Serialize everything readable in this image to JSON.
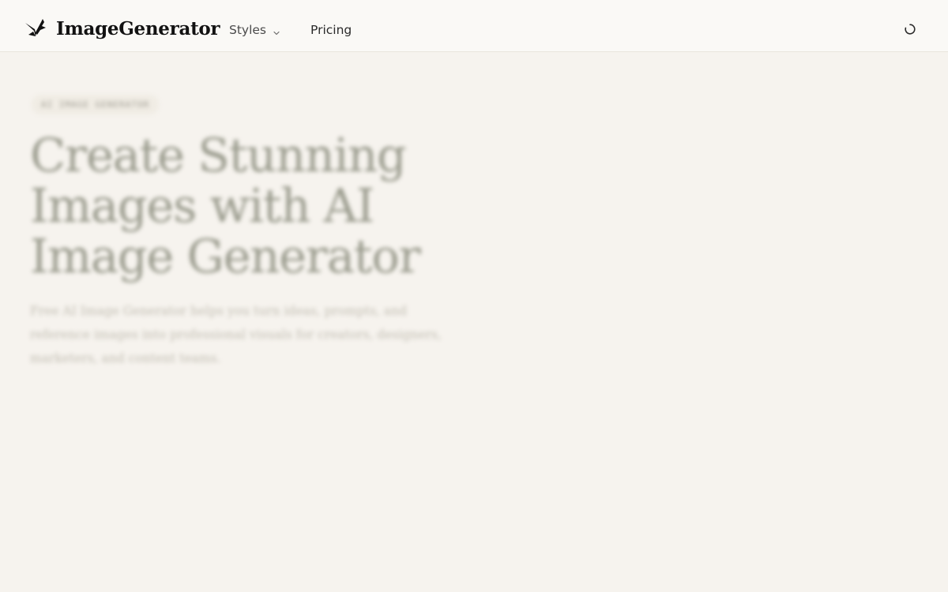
{
  "header": {
    "brand_name": "ImageGenerator",
    "logo_icon": "crane-bird-icon",
    "nav": {
      "styles_label": "Styles",
      "pricing_label": "Pricing"
    },
    "status_icon": "loading-spinner-icon"
  },
  "hero": {
    "eyebrow": "AI IMAGE GENERATOR",
    "headline": "Create Stunning Images with AI Image Generator",
    "description": "Free AI Image Generator helps you turn ideas, prompts, and reference images into professional visuals for creators, designers, marketers, and content teams."
  },
  "colors": {
    "page_background": "#f6f3ee",
    "header_background": "#faf9f6",
    "headline_text": "#9a9b8d"
  }
}
